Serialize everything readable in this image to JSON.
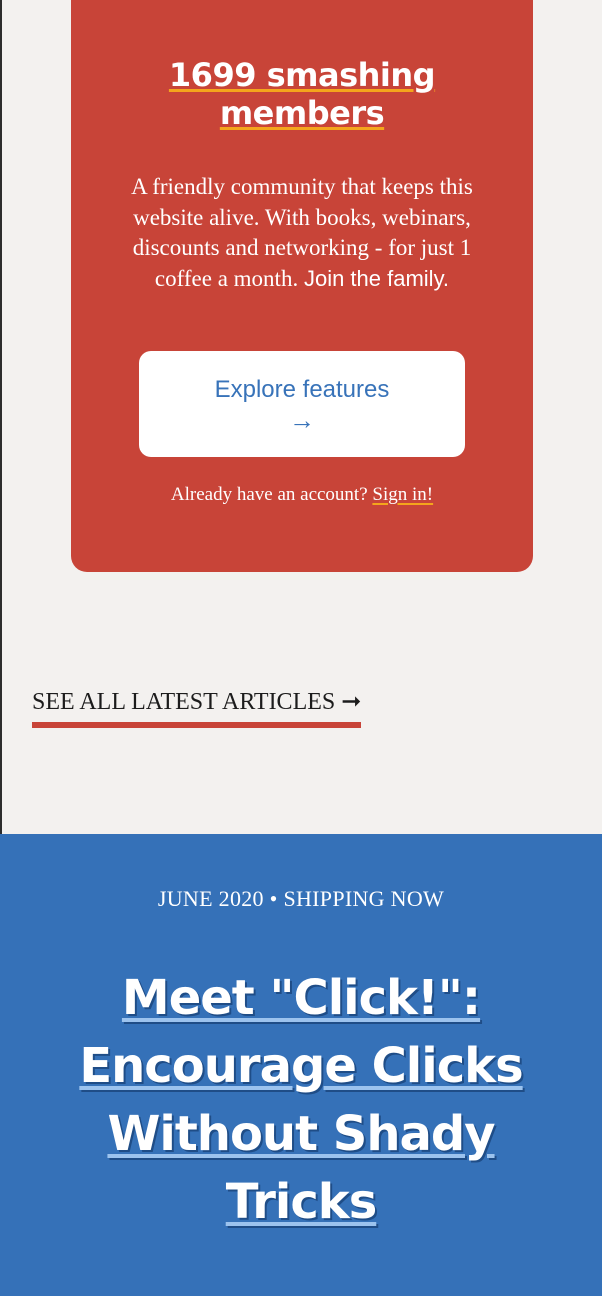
{
  "membership": {
    "title": "1699 smashing members",
    "description": "A friendly community that keeps this website alive. With books, webinars, discounts and networking - for just 1 coffee a month.",
    "join_text": "Join the family.",
    "button_label": "Explore features",
    "button_arrow": "→",
    "account_prompt": "Already have an account?",
    "signin_label": "Sign in!",
    "card_color": "#c84438",
    "accent_color": "#f4a51c"
  },
  "latest": {
    "label": "SEE ALL LATEST ARTICLES ➞",
    "underline_color": "#c84438"
  },
  "feature": {
    "meta": "JUNE 2020 • SHIPPING NOW",
    "title": "Meet \"Click!\": Encourage Clicks Without Shady Tricks",
    "background_color": "#3571b8"
  }
}
